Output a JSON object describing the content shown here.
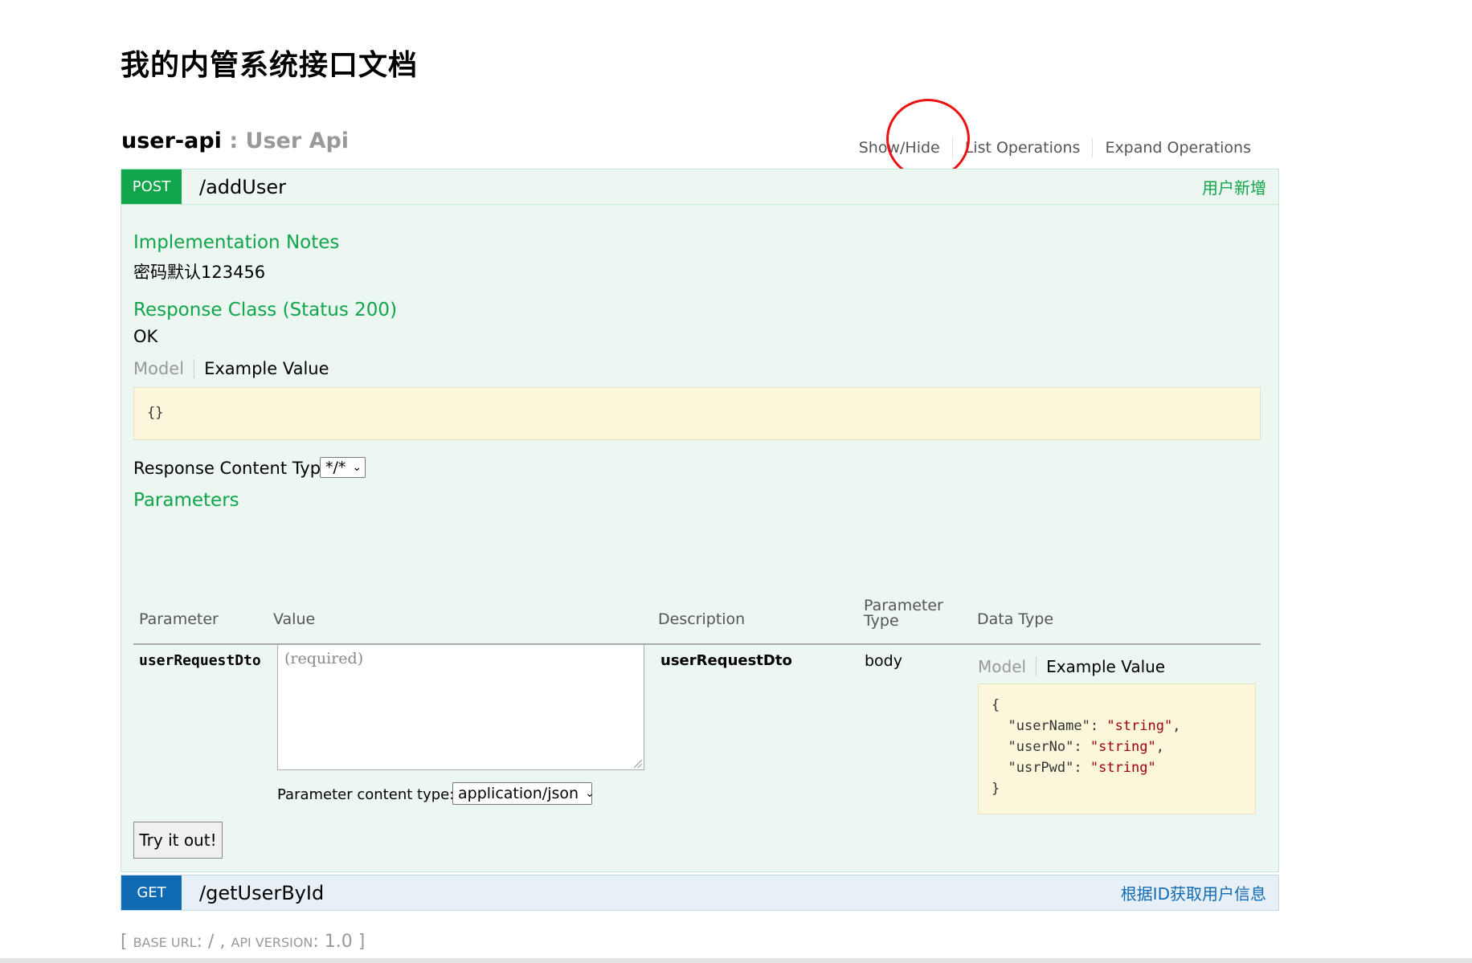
{
  "page": {
    "title": "我的内管系统接口文档"
  },
  "resource": {
    "name": "user-api",
    "separator": " : ",
    "description": "User Api",
    "ops": {
      "show_hide": "Show/Hide",
      "list": "List Operations",
      "expand": "Expand Operations"
    }
  },
  "post_op": {
    "method": "POST",
    "path": "/addUser",
    "summary": "用户新增",
    "impl_title": "Implementation Notes",
    "impl_text": "密码默认123456",
    "response_title": "Response Class (Status 200)",
    "response_text": "OK",
    "model_tab": "Model",
    "example_tab": "Example Value",
    "response_example": "{}",
    "content_type_label": "Response Content Type",
    "content_type_value": "*/*",
    "params_title": "Parameters",
    "params_headers": {
      "parameter": "Parameter",
      "value": "Value",
      "description": "Description",
      "type_line1": "Parameter",
      "type_line2": "Type",
      "data_type": "Data Type"
    },
    "param": {
      "name": "userRequestDto",
      "placeholder": "(required)",
      "description": "userRequestDto",
      "type": "body",
      "model_tab": "Model",
      "example_tab": "Example Value",
      "example": {
        "open": "{",
        "k1": "\"userName\"",
        "v1": "\"string\"",
        "k2": "\"userNo\"",
        "v2": "\"string\"",
        "k3": "\"usrPwd\"",
        "v3": "\"string\"",
        "close": "}"
      },
      "content_type_label": "Parameter content type:",
      "content_type_value": "application/json"
    },
    "try_button": "Try it out!"
  },
  "get_op": {
    "method": "GET",
    "path": "/getUserById",
    "summary": "根据ID获取用户信息"
  },
  "footer": {
    "open": "[ ",
    "base_url_label": "BASE URL",
    "base_url_value": ": / , ",
    "api_version_label": "API VERSION",
    "api_version_value": ": 1.0 ]"
  },
  "colors": {
    "post": "#10a54a",
    "get": "#0f6ab4",
    "annotation": "#e11111"
  }
}
